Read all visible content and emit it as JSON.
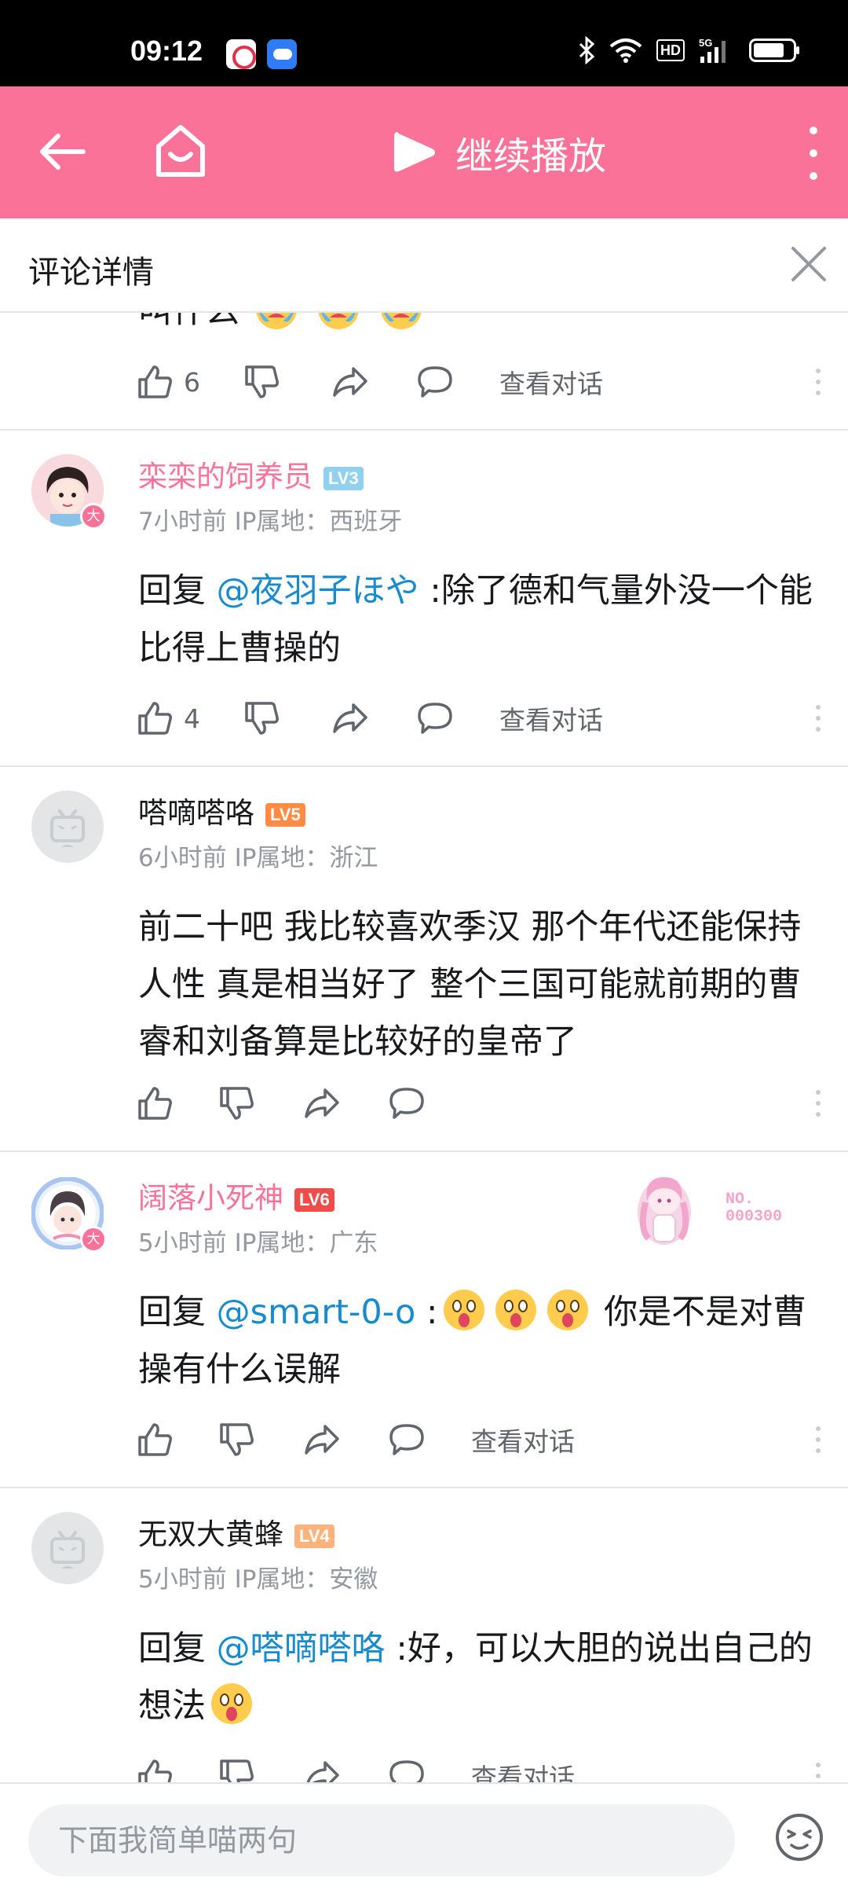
{
  "status_bar": {
    "time": "09:12",
    "hd": "HD",
    "network": "5G",
    "icons": [
      "app-icon-red",
      "app-icon-weather",
      "bluetooth-icon",
      "wifi-icon",
      "hd-icon",
      "signal-5g-icon",
      "battery-icon"
    ]
  },
  "header": {
    "continue_label": "继续播放",
    "icons": [
      "back-arrow-icon",
      "home-icon",
      "play-icon",
      "more-vertical-icon"
    ],
    "accent_color": "#fb7299"
  },
  "detail": {
    "title": "评论详情"
  },
  "comments": [
    {
      "partial_text": "叫什么",
      "likes": "6",
      "view_conversation": "查看对话"
    },
    {
      "username": "栾栾的饲养员",
      "level": "LV3",
      "level_color": "#8fd1ee",
      "badge": "大",
      "meta": "7小时前 IP属地：西班牙",
      "reply_prefix": "回复 ",
      "mention": "@夜羽子ほや",
      "text": " :除了德和气量外没一个能比得上曹操的",
      "likes": "4",
      "view_conversation": "查看对话"
    },
    {
      "username": "嗒嘀嗒咯",
      "level": "LV5",
      "level_color": "#ff8c42",
      "meta": "6小时前 IP属地：浙江",
      "text": "前二十吧 我比较喜欢季汉 那个年代还能保持人性 真是相当好了 整个三国可能就前期的曹睿和刘备算是比较好的皇帝了"
    },
    {
      "username": "阔落小死神",
      "level": "LV6",
      "level_color": "#f04c49",
      "badge": "大",
      "meta": "5小时前 IP属地：广东",
      "nameplate_no": "NO.\n000300",
      "reply_prefix": "回复 ",
      "mention": "@smart-0-o",
      "text_before_emoji": " :",
      "text_after_emoji": " 你是不是对曹操有什么误解",
      "view_conversation": "查看对话"
    },
    {
      "username": "无双大黄蜂",
      "level": "LV4",
      "level_color": "#ffb37c",
      "meta": "5小时前 IP属地：安徽",
      "reply_prefix": "回复 ",
      "mention": "@嗒嘀嗒咯",
      "text": " :好，可以大胆的说出自己的想法",
      "view_conversation": "查看对话"
    }
  ],
  "bottom": {
    "placeholder": "下面我简单喵两句",
    "icons": [
      "emoji-face-icon"
    ]
  }
}
